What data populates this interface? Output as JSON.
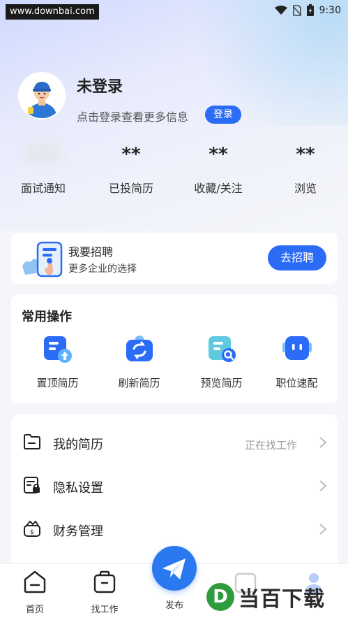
{
  "statusbar": {
    "watermark": "www.downbai.com",
    "time": "9:30"
  },
  "profile": {
    "name": "未登录",
    "tip": "点击登录查看更多信息",
    "login_label": "登录"
  },
  "stats": [
    {
      "value": "",
      "label": "面试通知"
    },
    {
      "value": "**",
      "label": "已投简历"
    },
    {
      "value": "**",
      "label": "收藏/关注"
    },
    {
      "value": "**",
      "label": "浏览"
    }
  ],
  "recruit": {
    "title": "我要招聘",
    "subtitle": "更多企业的选择",
    "button": "去招聘"
  },
  "ops": {
    "title": "常用操作",
    "items": [
      {
        "label": "置顶简历",
        "icon": "resume-top-icon"
      },
      {
        "label": "刷新简历",
        "icon": "refresh-resume-icon"
      },
      {
        "label": "预览简历",
        "icon": "preview-resume-icon"
      },
      {
        "label": "职位速配",
        "icon": "job-match-icon"
      }
    ]
  },
  "menu": [
    {
      "label": "我的简历",
      "sub": "正在找工作",
      "icon": "folder-icon"
    },
    {
      "label": "隐私设置",
      "sub": "",
      "icon": "privacy-lock-icon"
    },
    {
      "label": "财务管理",
      "sub": "",
      "icon": "wallet-icon"
    }
  ],
  "tabbar": {
    "home": "首页",
    "jobs": "找工作",
    "publish": "发布"
  },
  "brand": {
    "letter": "D",
    "text": "当百下载"
  },
  "colors": {
    "accent": "#2a6cf6",
    "fab": "#2a79f0"
  }
}
